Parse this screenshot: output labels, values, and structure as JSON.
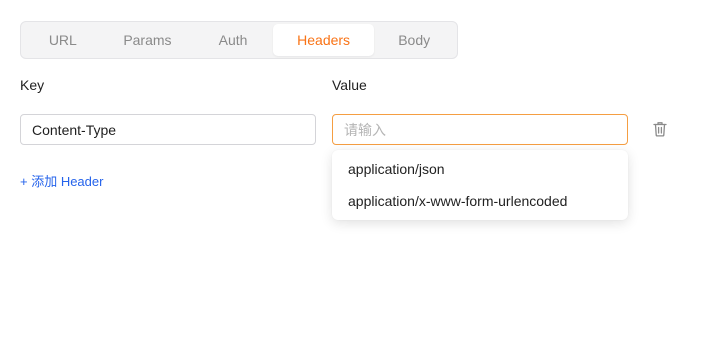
{
  "tabs": [
    {
      "label": "URL",
      "active": false
    },
    {
      "label": "Params",
      "active": false
    },
    {
      "label": "Auth",
      "active": false
    },
    {
      "label": "Headers",
      "active": true
    },
    {
      "label": "Body",
      "active": false
    }
  ],
  "columns": {
    "key_label": "Key",
    "value_label": "Value"
  },
  "row": {
    "key_value": "Content-Type",
    "value_placeholder": "请输入",
    "value_value": ""
  },
  "add_header_label": "+ 添加 Header",
  "dropdown": {
    "options": [
      "application/json",
      "application/x-www-form-urlencoded"
    ]
  },
  "colors": {
    "accent": "#f97316",
    "link": "#2563eb",
    "focus_border": "#f59e42"
  },
  "icons": {
    "delete": "trash-icon"
  }
}
